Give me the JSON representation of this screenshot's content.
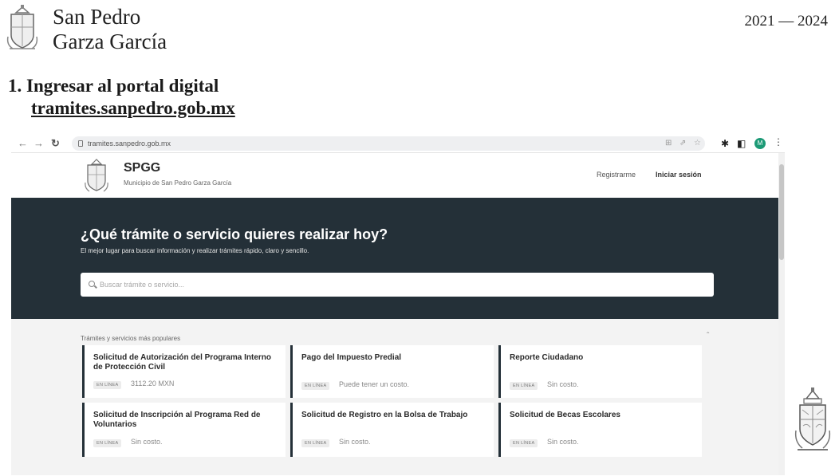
{
  "slide": {
    "org_line1": "San Pedro",
    "org_line2": "Garza García",
    "years": "2021 — 2024",
    "step_title": "1. Ingresar al portal digital",
    "step_url": "tramites.sanpedro.gob.mx"
  },
  "browser": {
    "address": "tramites.sanpedro.gob.mx",
    "profile_initial": "M"
  },
  "site": {
    "title": "SPGG",
    "subtitle": "Municipio de San Pedro Garza García",
    "register_label": "Registrarme",
    "login_label": "Iniciar sesión"
  },
  "hero": {
    "title": "¿Qué trámite o servicio quieres realizar hoy?",
    "subtitle": "El mejor lugar para buscar información y realizar trámites rápido, claro y sencillo.",
    "search_placeholder": "Buscar trámite o servicio..."
  },
  "popular": {
    "heading": "Trámites y servicios más populares",
    "cards": [
      {
        "title": "Solicitud de Autorización del Programa Interno de Protección Civil",
        "badge": "EN LÍNEA",
        "cost": "3112.20 MXN"
      },
      {
        "title": "Pago del Impuesto Predial",
        "badge": "EN LÍNEA",
        "cost": "Puede tener un costo."
      },
      {
        "title": "Reporte Ciudadano",
        "badge": "EN LÍNEA",
        "cost": "Sin costo."
      },
      {
        "title": "Solicitud de Inscripción al Programa Red de Voluntarios",
        "badge": "EN LÍNEA",
        "cost": "Sin costo."
      },
      {
        "title": "Solicitud de Registro en la Bolsa de Trabajo",
        "badge": "EN LÍNEA",
        "cost": "Sin costo."
      },
      {
        "title": "Solicitud de Becas Escolares",
        "badge": "EN LÍNEA",
        "cost": "Sin costo."
      }
    ]
  },
  "colors": {
    "hero_background": "#243038",
    "card_accent": "#243038",
    "profile_avatar": "#1c9a76"
  },
  "icons": [
    "coat-of-arms-icon",
    "back-arrow-icon",
    "forward-arrow-icon",
    "reload-icon",
    "lock-icon",
    "translate-icon",
    "share-icon",
    "bookmark-star-icon",
    "extensions-icon",
    "sidebar-icon",
    "kebab-menu-icon",
    "search-icon",
    "chevron-up-icon"
  ]
}
